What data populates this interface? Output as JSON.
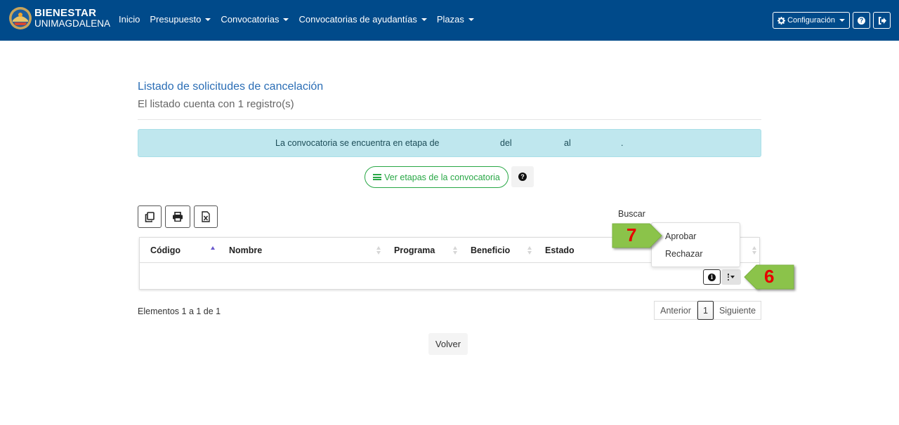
{
  "brand": {
    "line1": "BIENESTAR",
    "line2": "UNIMAGDALENA",
    "logo_icon": "university-seal-icon"
  },
  "nav": {
    "items": [
      {
        "label": "Inicio",
        "dropdown": false
      },
      {
        "label": "Presupuesto",
        "dropdown": true
      },
      {
        "label": "Convocatorias",
        "dropdown": true
      },
      {
        "label": "Convocatorias de ayudantías",
        "dropdown": true
      },
      {
        "label": "Plazas",
        "dropdown": true
      }
    ],
    "config_label": "Configuración",
    "config_icon": "gear-icon",
    "help_icon": "question-circle-icon",
    "logout_icon": "sign-out-icon",
    "color": "#004a8a"
  },
  "page": {
    "title": "Listado de solicitudes de cancelación",
    "subtitle": "El listado cuenta con 1 registro(s)"
  },
  "alert": {
    "text": "La convocatoria se encuentra en etapa de",
    "del": "del",
    "al": "al",
    "period": ".",
    "color": "#bfe7ee"
  },
  "stages_button": {
    "label": "Ver etapas de la convocatoria",
    "icon": "list-icon",
    "color": "#28a745"
  },
  "toolbar": {
    "copy_icon": "copy-icon",
    "print_icon": "print-icon",
    "excel_icon": "excel-file-icon"
  },
  "search": {
    "label": "Buscar"
  },
  "table": {
    "columns": [
      "Código",
      "Nombre",
      "Programa",
      "Beneficio",
      "Estado"
    ],
    "sorted_column": "Código",
    "row_actions": {
      "info_icon": "info-circle-icon",
      "menu_icon": "vertical-ellipsis-icon"
    }
  },
  "dropdown": {
    "items": [
      "Aprobar",
      "Rechazar"
    ]
  },
  "annotations": {
    "step6": "6",
    "step7": "7",
    "arrow_color": "#8bc34a",
    "number_color": "#e60000"
  },
  "footer": {
    "info": "Elementos 1 a 1 de 1",
    "prev": "Anterior",
    "page": "1",
    "next": "Siguiente",
    "back": "Volver"
  }
}
